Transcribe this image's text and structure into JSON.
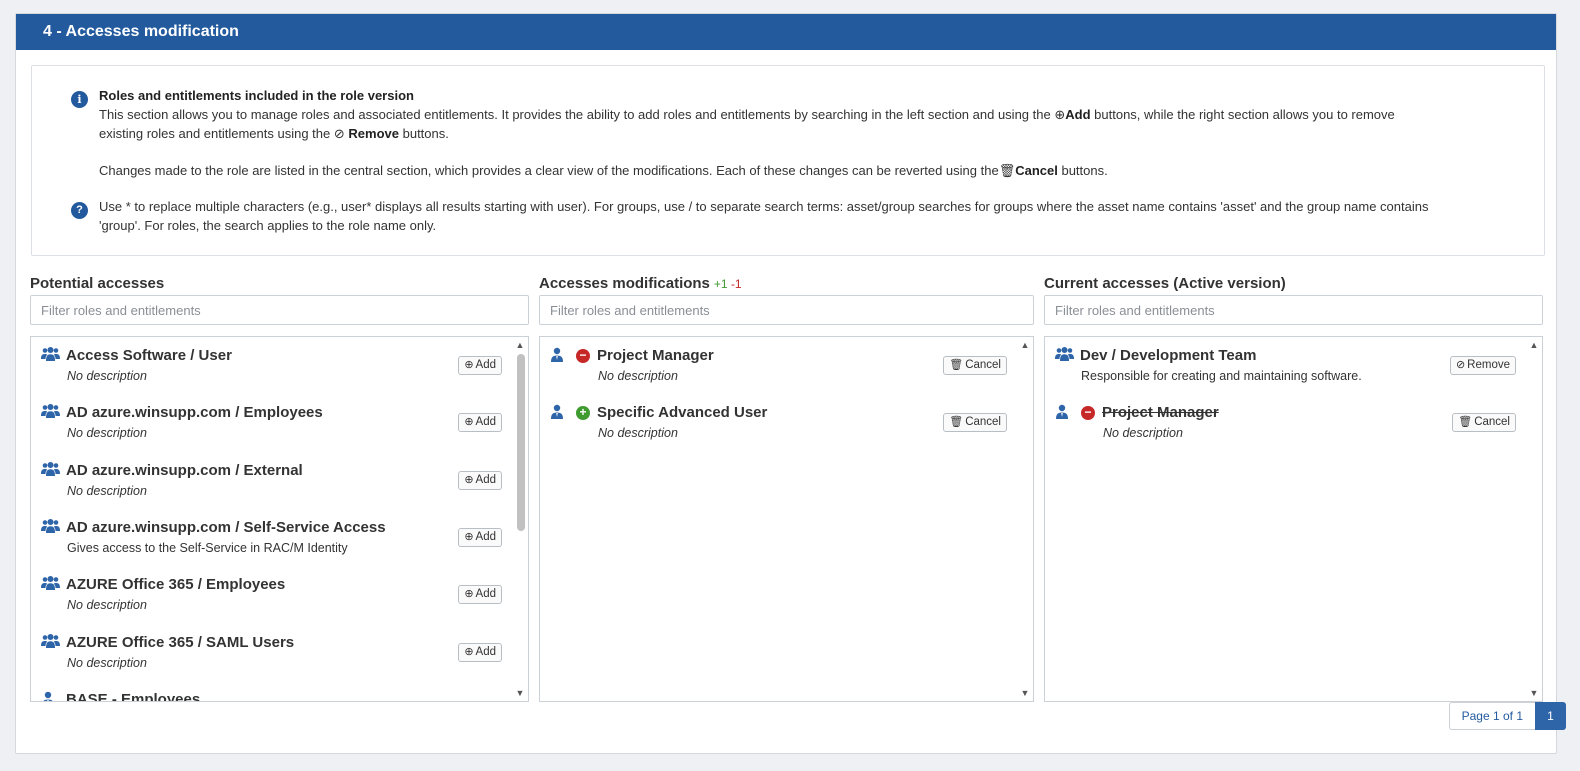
{
  "section": {
    "title": "4 - Accesses modification"
  },
  "info": {
    "heading": "Roles and entitlements included in the role version",
    "line1_a": "This section allows you to manage roles and associated entitlements. It provides the ability to add roles and entitlements by searching in the left section and using the",
    "add_word": "Add",
    "line1_b": "buttons, while the right section allows you to remove",
    "line2_a": "existing roles and entitlements using the",
    "remove_word": "Remove",
    "line2_b": "buttons.",
    "line3_a": "Changes made to the role are listed in the central section, which provides a clear view of the modifications. Each of these changes can be reverted using the",
    "cancel_word": "Cancel",
    "line3_b": "buttons.",
    "help_line1": "Use * to replace multiple characters (e.g., user* displays all results starting with user). For groups, use / to separate search terms: asset/group searches for groups where the asset name contains 'asset' and the group name contains",
    "help_line2": "'group'. For roles, the search applies to the role name only."
  },
  "potential": {
    "title": "Potential accesses",
    "placeholder": "Filter roles and entitlements",
    "items": [
      {
        "icon": "group-icon",
        "name": "Access Software / User",
        "desc": "No description",
        "button": "Add"
      },
      {
        "icon": "group-icon",
        "name": "AD azure.winsupp.com / Employees",
        "desc": "No description",
        "button": "Add"
      },
      {
        "icon": "group-icon",
        "name": "AD azure.winsupp.com / External",
        "desc": "No description",
        "button": "Add"
      },
      {
        "icon": "group-icon",
        "name": "AD azure.winsupp.com / Self-Service Access",
        "desc": "Gives access to the Self-Service in RAC/M Identity",
        "button": "Add"
      },
      {
        "icon": "group-icon",
        "name": "AZURE Office 365 / Employees",
        "desc": "No description",
        "button": "Add"
      },
      {
        "icon": "group-icon",
        "name": "AZURE Office 365 / SAML Users",
        "desc": "No description",
        "button": "Add"
      },
      {
        "icon": "user-icon",
        "name": "BASE - Employees",
        "desc": "",
        "button": ""
      }
    ]
  },
  "modifications": {
    "title": "Accesses modifications",
    "added_count": "+1",
    "removed_count": "-1",
    "placeholder": "Filter roles and entitlements",
    "items": [
      {
        "icon": "user-icon",
        "status": "removed",
        "name": "Project Manager",
        "desc": "No description",
        "button": "Cancel"
      },
      {
        "icon": "user-icon",
        "status": "added",
        "name": "Specific Advanced User",
        "desc": "No description",
        "button": "Cancel"
      }
    ]
  },
  "current": {
    "title": "Current accesses (Active version)",
    "placeholder": "Filter roles and entitlements",
    "items": [
      {
        "icon": "group-icon",
        "name": "Dev / Development Team",
        "desc": "Responsible for creating and maintaining software.",
        "button": "Remove"
      },
      {
        "icon": "user-icon",
        "status": "removed",
        "name": "Project Manager",
        "desc": "No description",
        "button": "Cancel"
      }
    ]
  },
  "pagination": {
    "info": "Page 1 of 1",
    "current": "1"
  },
  "colors": {
    "header": "#235a9e",
    "added": "#3f9a2f",
    "removed": "#c62828",
    "icon": "#2e64a8"
  }
}
